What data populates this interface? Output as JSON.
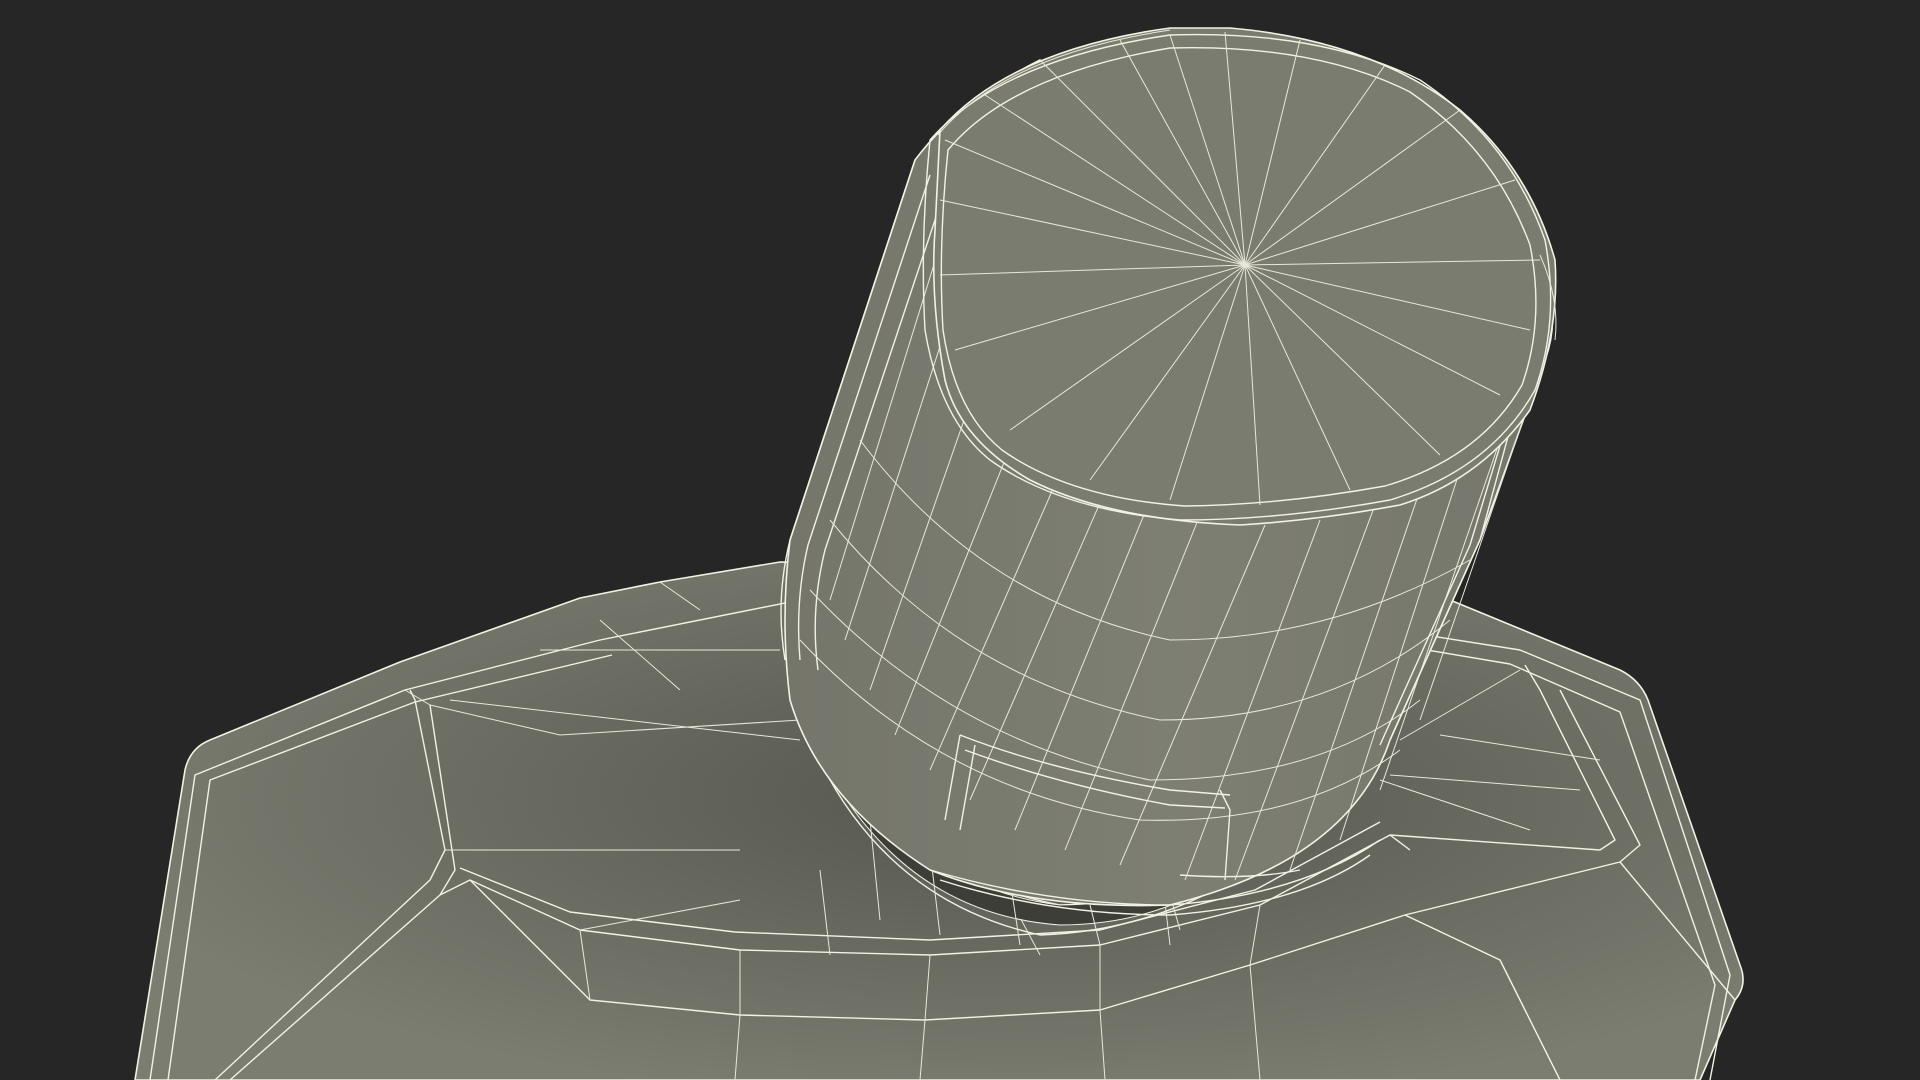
{
  "scene": {
    "subject": "wireframe-bottle-with-cap",
    "colors": {
      "background": "#262626",
      "surface_light": "#7b7c70",
      "surface_dark": "#5a5b52",
      "wireframe": "#f2f2e4"
    }
  }
}
